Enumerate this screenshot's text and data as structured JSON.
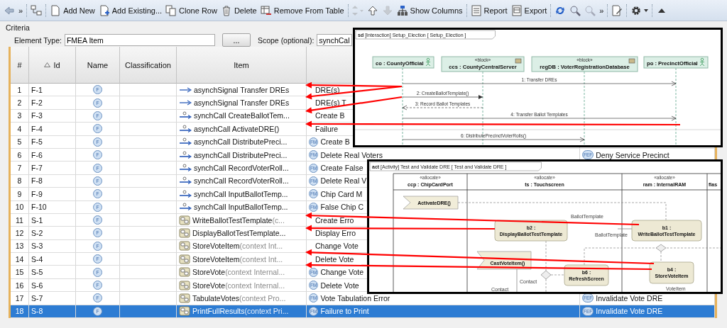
{
  "toolbar": {
    "items": [
      {
        "kind": "back",
        "disabled": false
      },
      {
        "kind": "more",
        "label": "»",
        "disabled": false
      },
      {
        "kind": "separator"
      },
      {
        "kind": "tree",
        "disabled": false
      },
      {
        "kind": "separator"
      },
      {
        "kind": "new",
        "label": "Add New",
        "disabled": false
      },
      {
        "kind": "add-existing",
        "label": "Add Existing...",
        "disabled": false
      },
      {
        "kind": "clone",
        "label": "Clone Row",
        "disabled": false
      },
      {
        "kind": "delete",
        "label": "Delete",
        "disabled": false
      },
      {
        "kind": "remove",
        "label": "Remove From Table",
        "disabled": false
      },
      {
        "kind": "separator"
      },
      {
        "kind": "move",
        "disabled": true
      },
      {
        "kind": "up",
        "disabled": false
      },
      {
        "kind": "down",
        "disabled": true
      },
      {
        "kind": "columns",
        "label": "Show Columns",
        "disabled": false
      },
      {
        "kind": "separator"
      },
      {
        "kind": "report",
        "label": "Report",
        "disabled": false
      },
      {
        "kind": "export",
        "label": "Export",
        "disabled": false
      },
      {
        "kind": "separator"
      },
      {
        "kind": "refresh",
        "disabled": false
      },
      {
        "kind": "zoom",
        "disabled": false
      },
      {
        "kind": "zoom",
        "disabled": true
      },
      {
        "kind": "more",
        "label": "»",
        "disabled": false
      },
      {
        "kind": "separator"
      },
      {
        "kind": "tool",
        "disabled": false
      },
      {
        "kind": "separator"
      },
      {
        "kind": "gear",
        "disabled": false
      },
      {
        "kind": "separator"
      },
      {
        "kind": "collapse",
        "disabled": false
      }
    ]
  },
  "criteria": {
    "title": "Criteria",
    "element_type": {
      "label": "Element Type:",
      "value": "FMEA Item"
    },
    "browse": "...",
    "scope": {
      "label": "Scope (optional):",
      "value": "synchCal"
    }
  },
  "table": {
    "columns": [
      {
        "label": "#",
        "sorted": false
      },
      {
        "label": "Id",
        "sorted": true
      },
      {
        "label": "Name",
        "sorted": false
      },
      {
        "label": "Classification",
        "sorted": false
      },
      {
        "label": "Item",
        "sorted": false
      }
    ],
    "rows": [
      {
        "num": "1",
        "id": "F-1",
        "name_icon": "F",
        "item": {
          "kind": "signal",
          "text": "asynchSignal Transfer DREs"
        },
        "mode": "DRE(s)",
        "selected": false
      },
      {
        "num": "2",
        "id": "F-2",
        "name_icon": "F",
        "item": {
          "kind": "signal",
          "text": "asynchSignal Transfer DREs"
        },
        "mode": "DRE(s) T",
        "selected": false
      },
      {
        "num": "3",
        "id": "F-3",
        "name_icon": "F",
        "item": {
          "kind": "call",
          "text": "synchCall CreateBallotTem..."
        },
        "mode": "Create B",
        "selected": false
      },
      {
        "num": "4",
        "id": "F-4",
        "name_icon": "F",
        "item": {
          "kind": "call",
          "text": "asynchCall ActivateDRE()"
        },
        "mode": "Failure",
        "selected": false
      },
      {
        "num": "5",
        "id": "F-5",
        "name_icon": "F",
        "item": {
          "kind": "call",
          "text": "asynchCall DistributePreci..."
        },
        "mode_icon": "FM",
        "mode": "Create B",
        "selected": false
      },
      {
        "num": "6",
        "id": "F-6",
        "name_icon": "F",
        "item": {
          "kind": "call",
          "text": "asynchCall DistributePreci..."
        },
        "mode_icon": "FM",
        "mode": "Delete Real Voters",
        "effect_icon": "FEF",
        "effect": "Deny Service Precinct",
        "selected": false
      },
      {
        "num": "7",
        "id": "F-7",
        "name_icon": "F",
        "item": {
          "kind": "call",
          "text": "synchCall RecordVoterRoll..."
        },
        "mode_icon": "FM",
        "mode": "Create False",
        "selected": false
      },
      {
        "num": "8",
        "id": "F-8",
        "name_icon": "F",
        "item": {
          "kind": "call",
          "text": "synchCall RecordVoterRoll..."
        },
        "mode_icon": "FM",
        "mode": "Delete Real V",
        "selected": false
      },
      {
        "num": "9",
        "id": "F-9",
        "name_icon": "F",
        "item": {
          "kind": "call",
          "text": "synchCall InputBallotTemp..."
        },
        "mode_icon": "FM",
        "mode": "Chip Card M",
        "selected": false
      },
      {
        "num": "10",
        "id": "F-10",
        "name_icon": "F",
        "item": {
          "kind": "call",
          "text": "synchCall InputBallotTemp..."
        },
        "mode_icon": "FM",
        "mode": "False Chip C",
        "selected": false
      },
      {
        "num": "11",
        "id": "S-1",
        "name_icon": "F",
        "item": {
          "kind": "action",
          "text": "WriteBallotTestTemplate",
          "context": "(c..."
        },
        "mode": "Create Erro",
        "selected": false
      },
      {
        "num": "12",
        "id": "S-2",
        "name_icon": "F",
        "item": {
          "kind": "action",
          "text": "DisplayBallotTestTemplate..."
        },
        "mode": "Display Erro",
        "selected": false
      },
      {
        "num": "13",
        "id": "S-3",
        "name_icon": "F",
        "item": {
          "kind": "action",
          "text": "StoreVoteItem",
          "context": "(context Int..."
        },
        "mode": "Change Vote",
        "selected": false
      },
      {
        "num": "14",
        "id": "S-4",
        "name_icon": "F",
        "item": {
          "kind": "action",
          "text": "StoreVoteItem",
          "context": "(context Int..."
        },
        "mode": "Delete Vote",
        "selected": false
      },
      {
        "num": "15",
        "id": "S-5",
        "name_icon": "F",
        "item": {
          "kind": "action",
          "text": "StoreVote",
          "context": "(context Internal..."
        },
        "mode_icon": "FM",
        "mode": "Change Vote",
        "selected": false
      },
      {
        "num": "16",
        "id": "S-6",
        "name_icon": "F",
        "item": {
          "kind": "action",
          "text": "StoreVote",
          "context": "(context Internal..."
        },
        "mode_icon": "FM",
        "mode": "Delete Vote",
        "selected": false
      },
      {
        "num": "17",
        "id": "S-7",
        "name_icon": "F",
        "item": {
          "kind": "action",
          "text": "TabulateVotes",
          "context": "(context Pro..."
        },
        "mode_icon": "FM",
        "mode": "Vote Tabulation Error",
        "effect_icon": "FEF",
        "effect": "Invalidate Vote DRE",
        "selected": false
      },
      {
        "num": "18",
        "id": "S-8",
        "name_icon": "F",
        "item": {
          "kind": "action",
          "text": "PrintFullResults",
          "context": "(context Pri..."
        },
        "mode_icon": "FM",
        "mode": "Failure to Print",
        "effect_icon": "FEF",
        "effect": "Invalidate Vote DRE",
        "selected": true
      }
    ]
  },
  "sequence_diagram": {
    "frame_kind": "sd",
    "frame_title": "[Interaction] Setup_Election [ Setup_Election ]",
    "lifelines": [
      {
        "kind": "actor",
        "name": "co : CountyOfficial"
      },
      {
        "kind": "block",
        "stereotype": "«block»",
        "name": "ccs : CountyCentralServer"
      },
      {
        "kind": "block",
        "stereotype": "«block»",
        "name": "regDB : VoterRegistrationDatabase"
      },
      {
        "kind": "actor",
        "name": "po : PrecinctOfficial"
      }
    ],
    "messages": [
      {
        "kind": "async",
        "label": "1: Transfer DREs"
      },
      {
        "kind": "sync",
        "label": "2: CreateBallotTemplate()"
      },
      {
        "kind": "reply",
        "label": "3: Record Ballot Templates"
      },
      {
        "kind": "async",
        "label": "4: Transfer Ballot Templates"
      },
      {
        "kind": "async",
        "label": "6: DistributePrecinctVoterRolls()"
      }
    ]
  },
  "activity_diagram": {
    "frame_kind": "act",
    "frame_title": "[Activity] Test and Validate DRE [ Test and Validate DRE ]",
    "partitions": [
      {
        "stereotype": "«allocate»",
        "name": "ccp : ChipCardPort"
      },
      {
        "stereotype": "«allocate»",
        "name": "ts : Touchscreen"
      },
      {
        "stereotype": "«allocate»",
        "name": "ram : InternalRAM"
      },
      {
        "name": "flas"
      }
    ],
    "nodes": [
      {
        "kind": "event",
        "label": "ActivateDRE()"
      },
      {
        "kind": "action",
        "prefix": "b2 :",
        "label": "DisplayBallotTestTemplate"
      },
      {
        "kind": "action",
        "prefix": "b1 :",
        "label": "WriteBallotTestTemplate"
      },
      {
        "kind": "event",
        "label": "CastVoteItem()"
      },
      {
        "kind": "action",
        "prefix": "b6 :",
        "label": "RefreshScreen"
      },
      {
        "kind": "action",
        "prefix": "b4 :",
        "label": "StoreVoteItem"
      }
    ],
    "pin_labels": [
      "BallotTemplate",
      "BallotTemplate",
      "Contact",
      "Contact",
      "VoteItem"
    ]
  }
}
